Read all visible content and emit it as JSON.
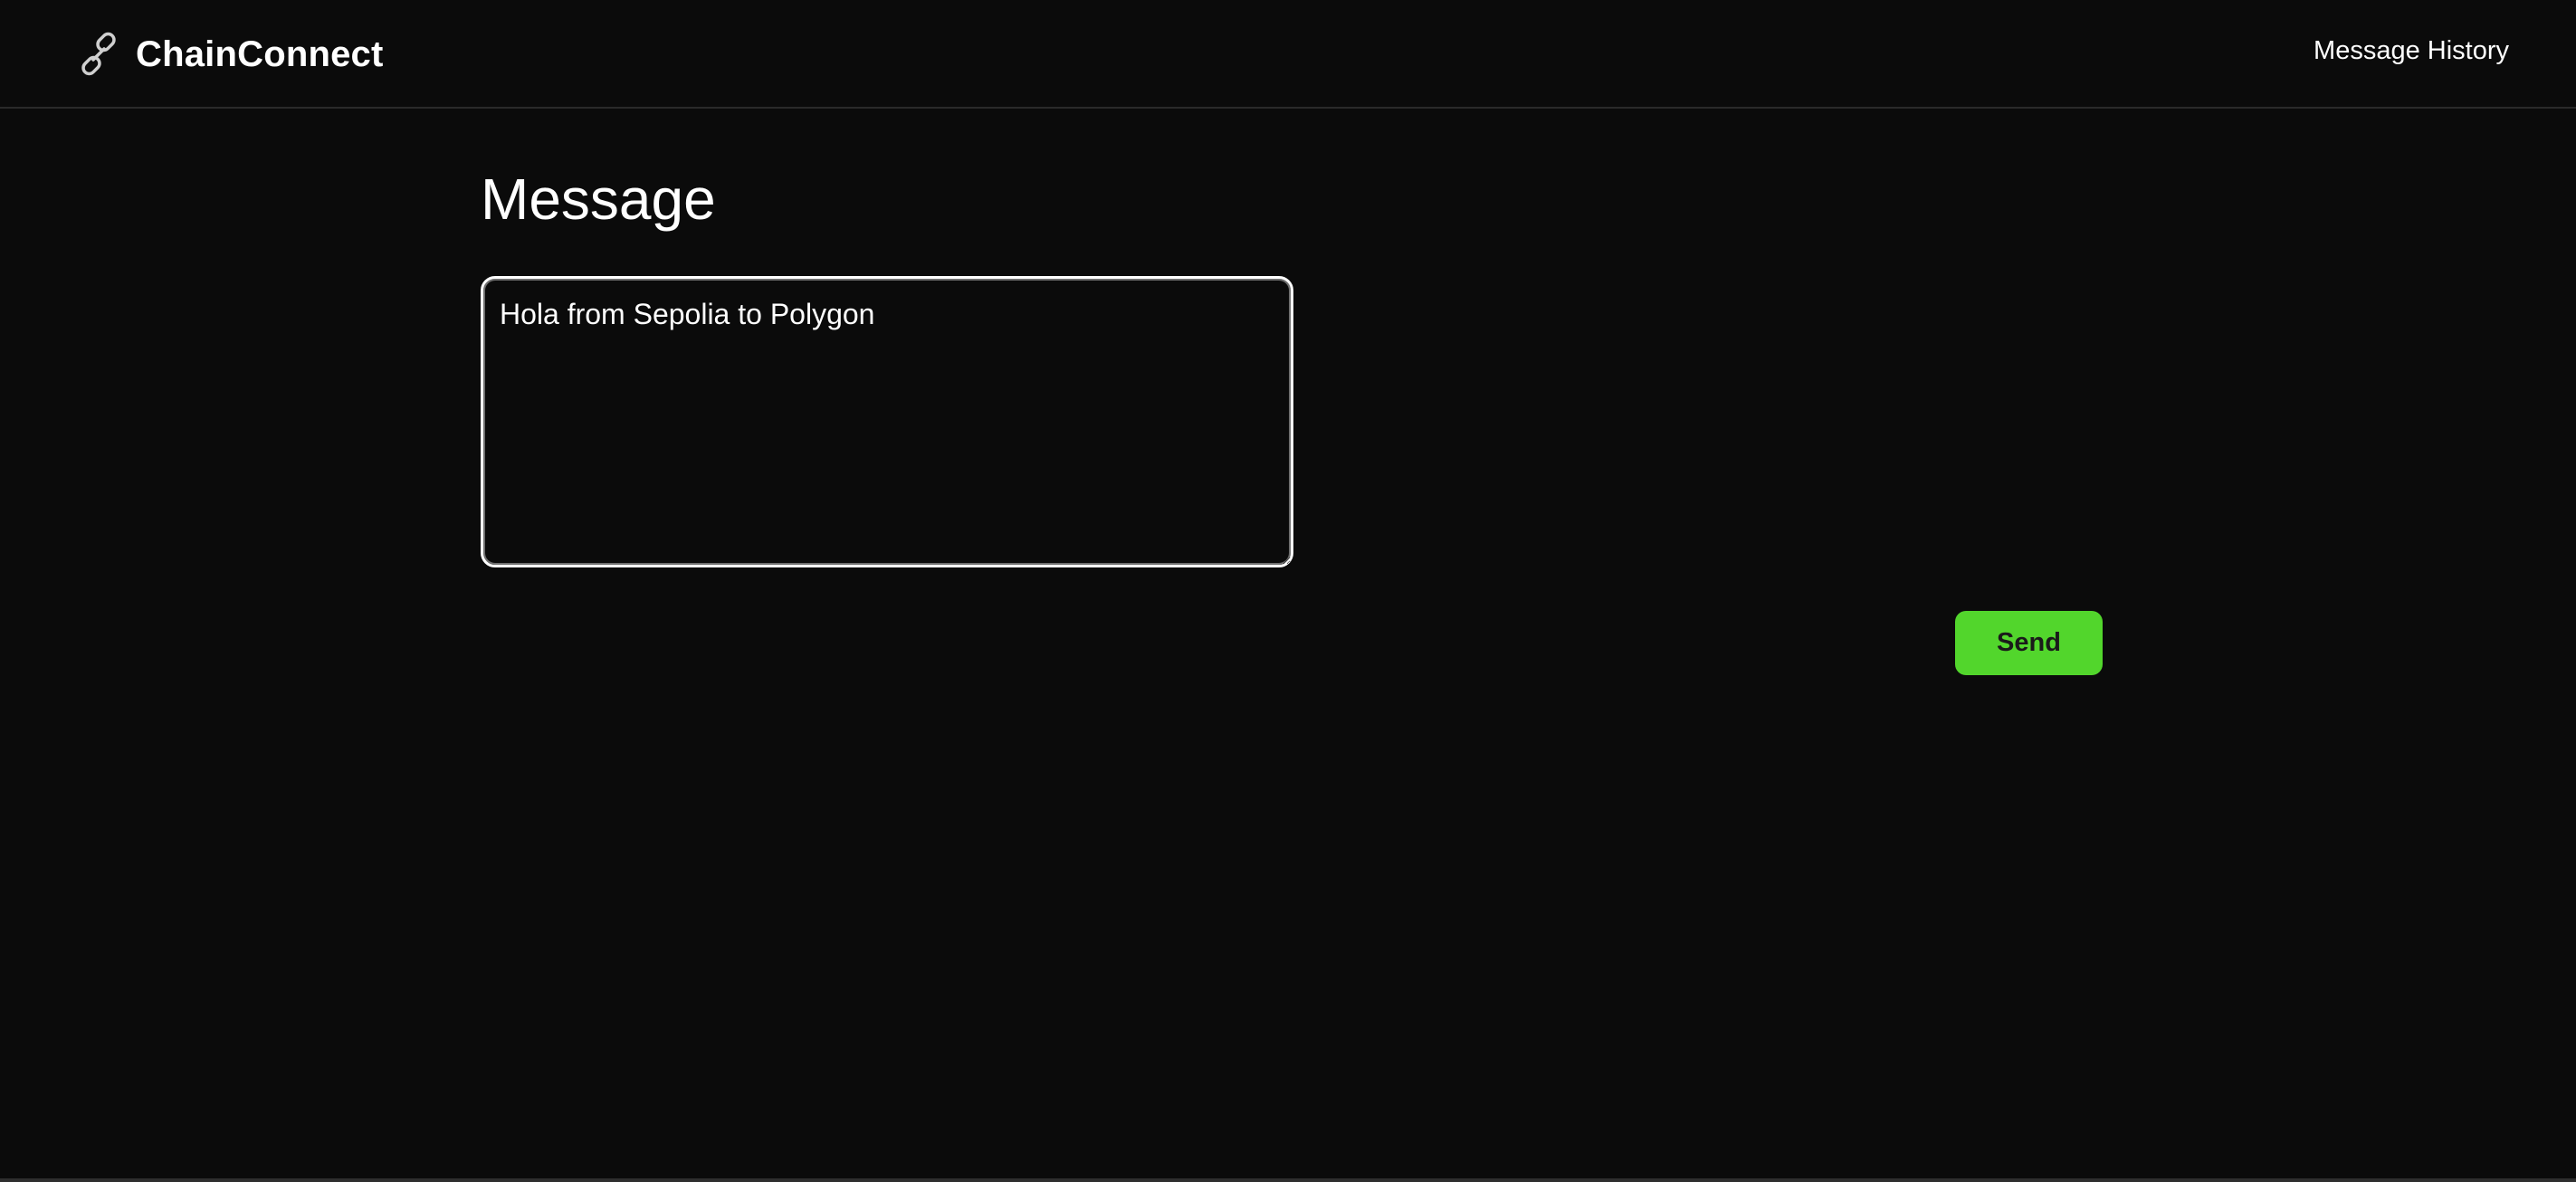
{
  "header": {
    "brand_name": "ChainConnect",
    "brand_icon": "link-chain-icon",
    "nav_link": "Message History"
  },
  "main": {
    "title": "Message",
    "message_value": "Hola from Sepolia to Polygon",
    "send_label": "Send"
  },
  "colors": {
    "background": "#0b0b0b",
    "text": "#ffffff",
    "accent": "#52d62c",
    "divider": "#2a2a2a"
  }
}
